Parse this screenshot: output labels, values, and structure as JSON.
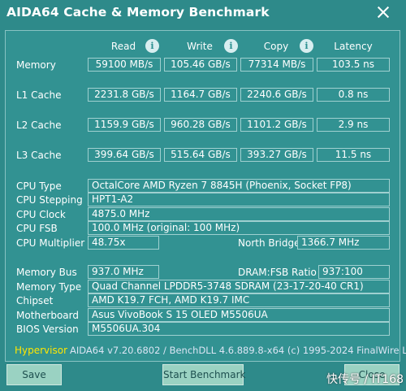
{
  "window": {
    "title": "AIDA64 Cache & Memory Benchmark"
  },
  "columns": {
    "read": "Read",
    "write": "Write",
    "copy": "Copy",
    "latency": "Latency"
  },
  "bench": [
    {
      "label": "Memory",
      "read": "59100 MB/s",
      "write": "105.46 GB/s",
      "copy": "77314 MB/s",
      "latency": "103.5 ns"
    },
    {
      "label": "L1 Cache",
      "read": "2231.8 GB/s",
      "write": "1164.7 GB/s",
      "copy": "2240.6 GB/s",
      "latency": "0.8 ns"
    },
    {
      "label": "L2 Cache",
      "read": "1159.9 GB/s",
      "write": "960.28 GB/s",
      "copy": "1101.2 GB/s",
      "latency": "2.9 ns"
    },
    {
      "label": "L3 Cache",
      "read": "399.64 GB/s",
      "write": "515.64 GB/s",
      "copy": "393.27 GB/s",
      "latency": "11.5 ns"
    }
  ],
  "cpu": {
    "type_label": "CPU Type",
    "type": "OctalCore AMD Ryzen 7 8845H  (Phoenix, Socket FP8)",
    "stepping_label": "CPU Stepping",
    "stepping": "HPT1-A2",
    "clock_label": "CPU Clock",
    "clock": "4875.0 MHz",
    "fsb_label": "CPU FSB",
    "fsb": "100.0 MHz  (original: 100 MHz)",
    "multiplier_label": "CPU Multiplier",
    "multiplier": "48.75x",
    "nb_clock_label": "North Bridge Clock",
    "nb_clock": "1366.7 MHz"
  },
  "system": {
    "membus_label": "Memory Bus",
    "membus": "937.0 MHz",
    "dram_ratio_label": "DRAM:FSB Ratio",
    "dram_ratio": "937:100",
    "memtype_label": "Memory Type",
    "memtype": "Quad Channel LPDDR5-3748 SDRAM  (23-17-20-40 CR1)",
    "chipset_label": "Chipset",
    "chipset": "AMD K19.7 FCH, AMD K19.7 IMC",
    "motherboard_label": "Motherboard",
    "motherboard": "Asus VivoBook S 15 OLED M5506UA",
    "bios_label": "BIOS Version",
    "bios": "M5506UA.304"
  },
  "footer": {
    "hypervisor": "Hypervisor",
    "copyright": "AIDA64 v7.20.6802 / BenchDLL 4.6.889.8-x64  (c) 1995-2024 FinalWire Ltd."
  },
  "buttons": {
    "save": "Save",
    "start": "Start Benchmark",
    "close": "Close"
  },
  "watermark": "快传号 / IT168",
  "icons": {
    "info": "i",
    "close": "close-icon"
  }
}
